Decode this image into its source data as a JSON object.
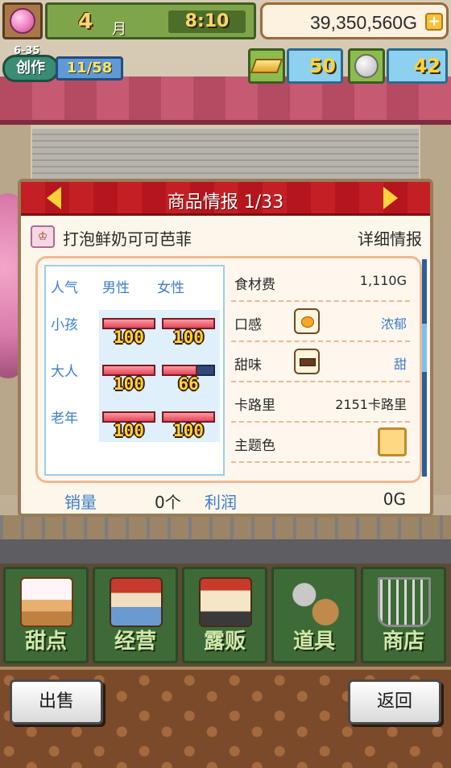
{
  "hud": {
    "month": "4",
    "month_unit": "月",
    "time": "8:10",
    "money": "39,350,560G",
    "create_date": "6-35",
    "create_label": "创作",
    "create_count": "11/58",
    "gold": "50",
    "medals": "42"
  },
  "dialog": {
    "title": "商品情报 1/33",
    "item_name": "打泡鲜奶可可芭菲",
    "detail_link": "详细情报",
    "popularity": {
      "headers": [
        "人气",
        "男性",
        "女性"
      ],
      "rows": [
        {
          "label": "小孩",
          "male": 100,
          "female": 100
        },
        {
          "label": "大人",
          "male": 100,
          "female": 66
        },
        {
          "label": "老年",
          "male": 100,
          "female": 100
        }
      ]
    },
    "attributes": {
      "cost_label": "食材费",
      "cost_value": "1,110G",
      "texture_label": "口感",
      "texture_value": "浓郁",
      "sweet_label": "甜味",
      "sweet_value": "甜",
      "calorie_label": "卡路里",
      "calorie_value": "2151卡路里",
      "theme_label": "主题色",
      "theme_color": "#ffd884"
    },
    "footer": {
      "sales_label": "销量",
      "sales_value": "0个",
      "profit_label": "利润",
      "profit_value": "0G"
    }
  },
  "menu": [
    {
      "label": "甜点",
      "icon": "cake-icon"
    },
    {
      "label": "经营",
      "icon": "shop-icon"
    },
    {
      "label": "露贩",
      "icon": "food-truck-icon"
    },
    {
      "label": "道具",
      "icon": "gear-bag-icon"
    },
    {
      "label": "商店",
      "icon": "cart-icon"
    }
  ],
  "buttons": {
    "sell": "出售",
    "back": "返回"
  }
}
